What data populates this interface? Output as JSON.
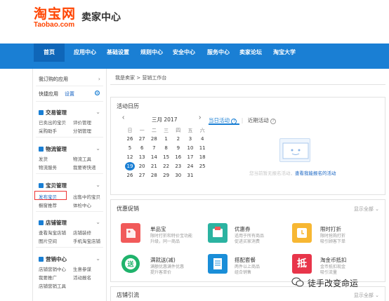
{
  "logo": {
    "cn": "淘宝网",
    "en": "Taobao.com"
  },
  "site_title": "卖家中心",
  "nav": [
    "首页",
    "应用中心",
    "基础设置",
    "规则中心",
    "安全中心",
    "服务中心",
    "卖家论坛",
    "淘宝大学"
  ],
  "sidebar": {
    "my_apps": "我订购的应用",
    "quick_apps": "快捷应用",
    "settings": "设置",
    "categories": [
      {
        "name": "交易管理",
        "links": [
          "已卖出的宝贝",
          "评价管理",
          "采购助手",
          "分销管理"
        ]
      },
      {
        "name": "物流管理",
        "links": [
          "发货",
          "物流工具",
          "物流服务",
          "我要寄快递"
        ]
      },
      {
        "name": "宝贝管理",
        "links": [
          "发布宝贝",
          "出售中的宝贝",
          "橱窗推荐",
          "体检中心"
        ]
      },
      {
        "name": "店铺管理",
        "links": [
          "查看淘宝店铺",
          "店铺装修",
          "图片空间",
          "手机淘宝店铺"
        ]
      },
      {
        "name": "营销中心",
        "links": [
          "店铺营销中心",
          "生意参谋",
          "我要推广",
          "活动报名",
          "店铺营销工具"
        ]
      }
    ]
  },
  "breadcrumb": "我是卖家 > 营销工作台",
  "calendar": {
    "title": "活动日历",
    "month": "三月 2017",
    "weekdays": [
      "日",
      "一",
      "二",
      "三",
      "四",
      "五",
      "六"
    ],
    "days": [
      [
        "26",
        "27",
        "28",
        "1",
        "2",
        "3",
        "4"
      ],
      [
        "5",
        "6",
        "7",
        "8",
        "9",
        "10",
        "11"
      ],
      [
        "12",
        "13",
        "14",
        "15",
        "16",
        "17",
        "18"
      ],
      [
        "19",
        "20",
        "21",
        "22",
        "23",
        "24",
        "25"
      ],
      [
        "26",
        "27",
        "28",
        "29",
        "30",
        "31",
        ""
      ]
    ],
    "today": "19",
    "tab_today": "当日活动",
    "tab_upcoming": "近期活动",
    "empty_text": "您当前暂无报名活动",
    "empty_link": "查看我能报名的活动"
  },
  "promo": {
    "title": "优惠促销",
    "more": "显示全部",
    "items": [
      {
        "name": "单品宝",
        "desc1": "限时打折和特价宝功能",
        "desc2": "升级，同一商品",
        "color": "#f15a5a",
        "icon": "discount-tag-icon"
      },
      {
        "name": "优惠券",
        "desc1": "适用于所有商品",
        "desc2": "促进买家消费",
        "color": "#2bb3a1",
        "icon": "coupon-icon"
      },
      {
        "name": "限时打折",
        "desc1": "限时抢购打折",
        "desc2": "吸引顾客下单",
        "color": "#f7b733",
        "icon": "clock-icon"
      },
      {
        "name": "满就送(减)",
        "desc1": "满额优惠满件优惠",
        "desc2": "提升客单价",
        "color": "#20b36c",
        "icon": "gift-icon"
      },
      {
        "name": "搭配套餐",
        "desc1": "两件以上商品",
        "desc2": "组合销售",
        "color": "#1a8ed8",
        "icon": "package-icon"
      },
      {
        "name": "淘金币抵扣",
        "desc1": "金币抵扣现金",
        "desc2": "吸引流量",
        "color": "#e8354a",
        "icon": "coin-icon",
        "glyph": "抵"
      }
    ]
  },
  "store_traffic": {
    "title": "店铺引流",
    "more": "显示全部"
  },
  "watermark": "徒手改变命运"
}
